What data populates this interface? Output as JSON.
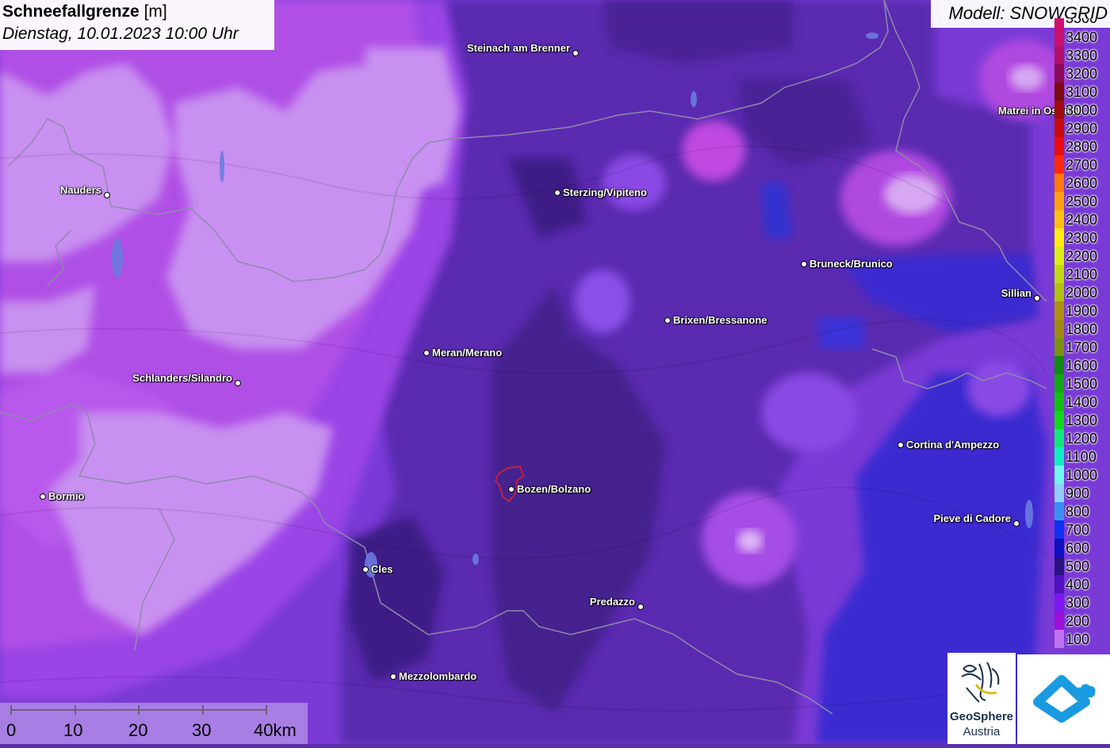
{
  "title": {
    "variable": "Schneefallgrenze",
    "unit": "[m]",
    "datetime": "Dienstag, 10.01.2023 10:00 Uhr"
  },
  "model_label": "Modell: SNOWGRID",
  "legend": {
    "top_label": "3500",
    "entries": [
      {
        "label": "3400",
        "color": "#c8106e"
      },
      {
        "label": "3300",
        "color": "#b0106a"
      },
      {
        "label": "3200",
        "color": "#8c0a5a"
      },
      {
        "label": "3100",
        "color": "#7a0a12"
      },
      {
        "label": "3000",
        "color": "#a00c0c"
      },
      {
        "label": "2900",
        "color": "#c80c0c"
      },
      {
        "label": "2800",
        "color": "#e80c0c"
      },
      {
        "label": "2700",
        "color": "#ff2a0a"
      },
      {
        "label": "2600",
        "color": "#ff7a0a"
      },
      {
        "label": "2500",
        "color": "#ffa010"
      },
      {
        "label": "2400",
        "color": "#ffc010"
      },
      {
        "label": "2300",
        "color": "#ffee10"
      },
      {
        "label": "2200",
        "color": "#d8ee10"
      },
      {
        "label": "2100",
        "color": "#c0d810"
      },
      {
        "label": "2000",
        "color": "#b0c010"
      },
      {
        "label": "1900",
        "color": "#b09010"
      },
      {
        "label": "1800",
        "color": "#a08a10"
      },
      {
        "label": "1700",
        "color": "#7a9010"
      },
      {
        "label": "1600",
        "color": "#108a10"
      },
      {
        "label": "1500",
        "color": "#10a810"
      },
      {
        "label": "1400",
        "color": "#10c010"
      },
      {
        "label": "1300",
        "color": "#10d81a"
      },
      {
        "label": "1200",
        "color": "#10e87a"
      },
      {
        "label": "1100",
        "color": "#10eec0"
      },
      {
        "label": "1000",
        "color": "#70f8f0"
      },
      {
        "label": "900",
        "color": "#90d0f8"
      },
      {
        "label": "800",
        "color": "#3a90f0"
      },
      {
        "label": "700",
        "color": "#1030f0"
      },
      {
        "label": "600",
        "color": "#1010c0"
      },
      {
        "label": "500",
        "color": "#2a1080"
      },
      {
        "label": "400",
        "color": "#5010c0"
      },
      {
        "label": "300",
        "color": "#7a18ee"
      },
      {
        "label": "200",
        "color": "#9a10d8"
      },
      {
        "label": "100",
        "color": "#c070ee"
      }
    ]
  },
  "cities": [
    {
      "name": "Steinach am Brenner"
    },
    {
      "name": "Nauders"
    },
    {
      "name": "Sterzing/Vipiteno"
    },
    {
      "name": "Matrei in Osttirol"
    },
    {
      "name": "Bruneck/Brunico"
    },
    {
      "name": "Sillian"
    },
    {
      "name": "Brixen/Bressanone"
    },
    {
      "name": "Meran/Merano"
    },
    {
      "name": "Schlanders/Silandro"
    },
    {
      "name": "Cortina d'Ampezzo"
    },
    {
      "name": "Bormio"
    },
    {
      "name": "Bozen/Bolzano"
    },
    {
      "name": "Pieve di Cadore"
    },
    {
      "name": "Cles"
    },
    {
      "name": "Predazzo"
    },
    {
      "name": "Mezzolombardo"
    }
  ],
  "scale": {
    "labels": [
      "0",
      "10",
      "20",
      "30",
      "40km"
    ]
  },
  "logo": {
    "line1": "GeoSphere",
    "line2": "Austria"
  },
  "colors": {
    "band_lightest": "#c890f0",
    "band_magenta": "#b040e0",
    "band_violet": "#8a40e8",
    "band_purple": "#7030c8",
    "band_dark": "#4a2490",
    "band_blue": "#3c30d8",
    "border_line": "#8888aa"
  }
}
